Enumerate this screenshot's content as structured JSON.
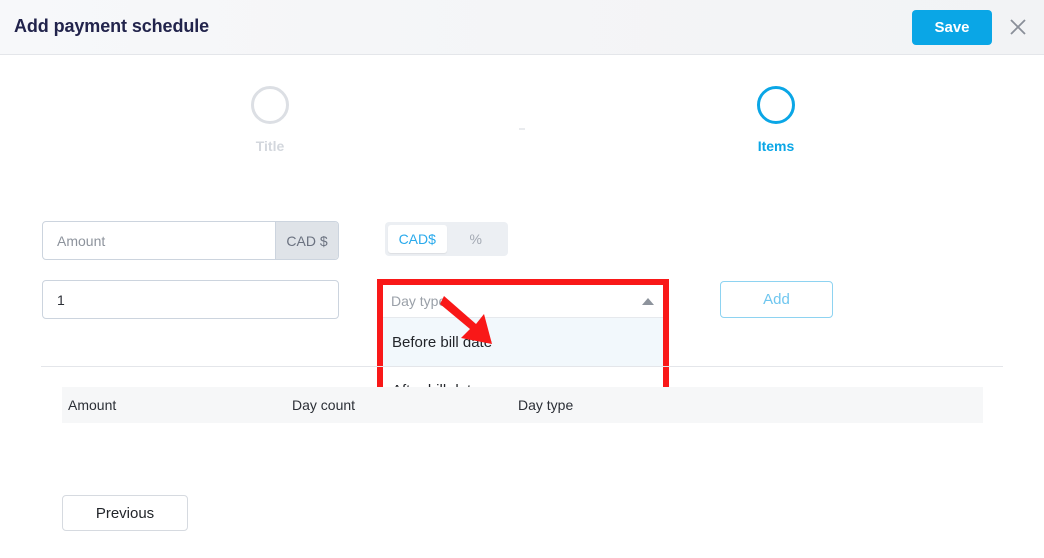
{
  "header": {
    "title": "Add payment schedule",
    "save_label": "Save",
    "close_icon": "close-icon"
  },
  "stepper": {
    "steps": [
      {
        "label": "Title",
        "state": "inactive"
      },
      {
        "label": "Items",
        "state": "active"
      }
    ]
  },
  "form": {
    "amount": {
      "placeholder": "Amount",
      "value": "",
      "addon_label": "CAD $"
    },
    "unit_toggle": {
      "options": [
        {
          "label": "CAD$",
          "selected": true
        },
        {
          "label": "%",
          "selected": false
        }
      ]
    },
    "day_count": {
      "value": "1",
      "placeholder": ""
    },
    "day_type": {
      "placeholder": "Day type",
      "value": "",
      "expanded": true,
      "chevron_icon": "chevron-up-icon",
      "options": [
        {
          "label": "Before bill date",
          "highlighted": true
        },
        {
          "label": "After bill date",
          "highlighted": false
        }
      ]
    },
    "add_label": "Add"
  },
  "table": {
    "columns": [
      "Amount",
      "Day count",
      "Day type"
    ],
    "rows": []
  },
  "footer": {
    "previous_label": "Previous"
  },
  "annotation": {
    "color": "#f91818",
    "shape": "box-and-arrow",
    "target": "Before bill date"
  }
}
